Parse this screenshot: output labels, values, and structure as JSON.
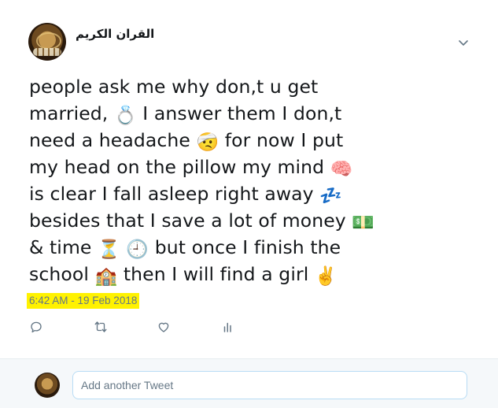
{
  "tweet": {
    "author": {
      "display_name": "القران الكريم",
      "avatar_icon": "quran-rosary-avatar"
    },
    "menu_icon": "chevron-down-icon",
    "text_lines": [
      [
        {
          "t": "people ask me why don,t u get"
        }
      ],
      [
        {
          "t": "married, "
        },
        {
          "e": "💍",
          "n": "ring-emoji"
        },
        {
          "t": " I answer them I don,t"
        }
      ],
      [
        {
          "t": "need a headache "
        },
        {
          "e": "🤕",
          "n": "head-bandage-emoji"
        },
        {
          "t": " for now I put"
        }
      ],
      [
        {
          "t": "my head on the pillow my mind "
        },
        {
          "e": "🧠",
          "n": "brain-emoji"
        }
      ],
      [
        {
          "t": "is clear I fall asleep right away "
        },
        {
          "e": "💤",
          "n": "zzz-emoji"
        }
      ],
      [
        {
          "t": "besides that I save a lot of money "
        },
        {
          "e": "💵",
          "n": "money-emoji"
        }
      ],
      [
        {
          "t": "& time  "
        },
        {
          "e": "⏳",
          "n": "hourglass-emoji"
        },
        {
          "t": " "
        },
        {
          "e": "🕘",
          "n": "clock-emoji"
        },
        {
          "t": " but once I finish the"
        }
      ],
      [
        {
          "t": "school "
        },
        {
          "e": "🏫",
          "n": "school-emoji"
        },
        {
          "t": " then I will find a girl  "
        },
        {
          "e": "✌️",
          "n": "victory-hand-emoji"
        }
      ]
    ],
    "timestamp": "6:42 AM - 19 Feb 2018",
    "timestamp_highlight": "#fff200",
    "actions": [
      "reply-icon",
      "retweet-icon",
      "like-icon",
      "analytics-icon"
    ]
  },
  "reply": {
    "placeholder": "Add another Tweet"
  },
  "colors": {
    "text": "#14171a",
    "muted": "#657786",
    "border": "#e6ecf0",
    "input_border": "#b8dcf5",
    "footer_bg": "#f5f8fa"
  }
}
